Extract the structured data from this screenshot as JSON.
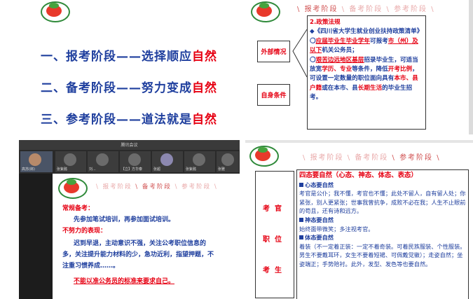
{
  "panel1": {
    "lines": [
      {
        "prefix": "一、报考阶段——选择顺应",
        "highlight": "自然"
      },
      {
        "prefix": "二、备考阶段——努力变成",
        "highlight": "自然"
      },
      {
        "prefix": "三、参考阶段——道法就是",
        "highlight": "自然"
      }
    ]
  },
  "panel2": {
    "header_sep": "\\",
    "header_active": "报考阶段",
    "header_item2": "备考阶段",
    "header_item3": "参考阶段",
    "label_outside": "外部情况",
    "label_self": "自身条件",
    "policy_title": "2.政策法规",
    "doc_title": "◆《四川省大学生就业创业扶持政策清单》",
    "p1_a": "〇",
    "p1_b": "应届毕业生毕业学年",
    "p1_c": "可报考",
    "p1_d": "市（州）及以下",
    "p1_e": "机关公务员；",
    "p2_a": "〇",
    "p2_b": "艰苦边远地区基层",
    "p2_c": "招录毕业生，可适当放宽",
    "p2_d": "学历、专业",
    "p2_e": "等条件，降低",
    "p2_f": "开考比例",
    "p2_g": "，可设置一定数量的职位面向具有",
    "p2_h": "本市、县户籍",
    "p2_i": "或在本市、县",
    "p2_j": "长期生活",
    "p2_k": "的毕业生招考。"
  },
  "panel3": {
    "window_title": "腾讯会议",
    "participants": [
      "高苏(郎)",
      "张紫懿",
      "刘...",
      "【立】方华泰",
      "张超",
      "张紫懿",
      "张雅"
    ],
    "header_item1": "报考阶段",
    "header_active": "备考阶段",
    "header_item3": "参考阶段",
    "section1": "常规备考：",
    "section1_body": "先参加笔试培训，再参加面试培训。",
    "section2": "不努力的表现：",
    "section2_body": "迟到早退，主动意识不强，关注公考职位信息的多，关注提升能力材料的少，急功近利，指望押题，不注重习惯养成……。",
    "closing": "不能以准公务员的标准来要求自己。"
  },
  "panel4": {
    "header_item1": "报考阶段",
    "header_item2": "备考阶段",
    "header_active": "参考阶段",
    "role_examiner": "考官",
    "role_position": "职位",
    "role_candidate": "考生",
    "heading": "四态要自然（心态、神态、体态、表态）",
    "xin_title": "心态要自然",
    "xin_body": "考官是公仆；我不懂，考官也不懂；此处不留人，自有留人处；你紧张，别人更紧张；世事我曾抗争，成败不必在我；人生不止眼前的苟且，还有诗和远方。",
    "shen_title": "神态要自然",
    "shen_body": "始终面带微笑；多注视考官。",
    "ti_title": "体态要自然",
    "ti_body": "着装（不一定着正装：一定不着奇装。可着民族服装、个性服装。男生不要戴耳环，女生不要着短裙、可佩戴党徽）；走姿自然；坐姿端正；手势陪衬。此外，发型、发色等也要自然。"
  }
}
